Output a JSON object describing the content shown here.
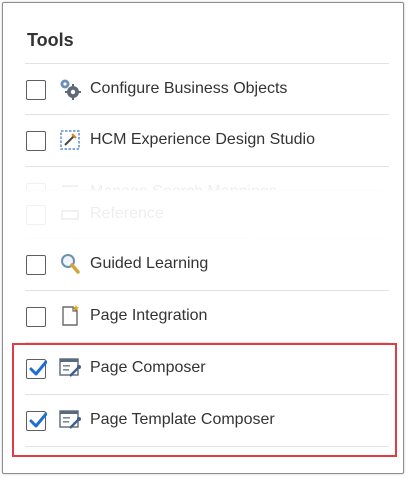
{
  "panel": {
    "title": "Tools",
    "items": [
      {
        "label": "Configure Business Objects",
        "checked": false,
        "icon": "gears-icon"
      },
      {
        "label": "HCM Experience Design Studio",
        "checked": false,
        "icon": "design-studio-icon"
      },
      {
        "label": "Manage Search Mappings",
        "checked": false,
        "icon": "list-icon"
      },
      {
        "label": "Reference",
        "checked": false,
        "icon": "link-icon"
      },
      {
        "label": "Guided Learning",
        "checked": false,
        "icon": "magnifier-icon"
      },
      {
        "label": "Page Integration",
        "checked": false,
        "icon": "page-integration-icon"
      },
      {
        "label": "Page Composer",
        "checked": true,
        "icon": "page-composer-icon"
      },
      {
        "label": "Page Template Composer",
        "checked": true,
        "icon": "page-template-composer-icon"
      }
    ]
  },
  "colors": {
    "checkmark": "#1d6fd3",
    "highlight_border": "#e03c48"
  }
}
